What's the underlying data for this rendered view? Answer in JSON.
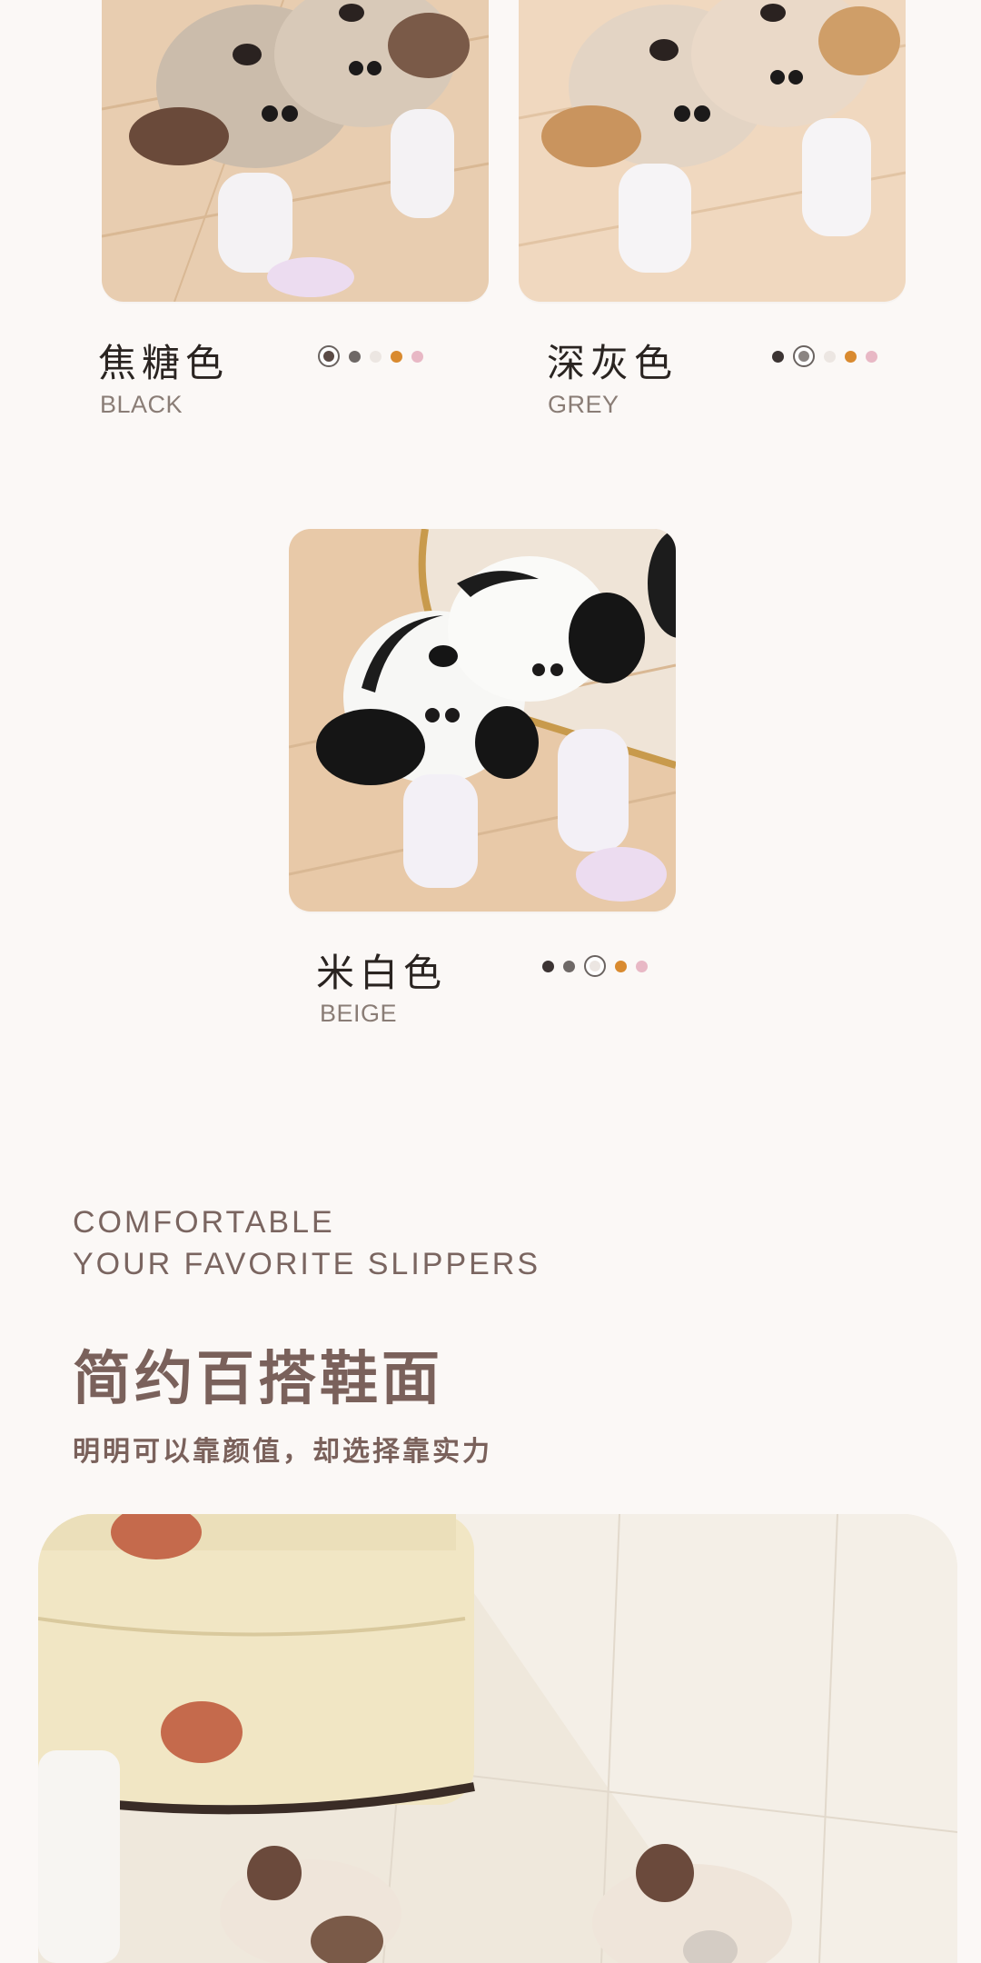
{
  "variants": [
    {
      "name_cn": "焦糖色",
      "name_en": "BLACK",
      "selected_index": 0
    },
    {
      "name_cn": "深灰色",
      "name_en": "GREY",
      "selected_index": 1
    },
    {
      "name_cn": "米白色",
      "name_en": "BEIGE",
      "selected_index": 2
    }
  ],
  "swatch_colors": [
    "#5a4a45",
    "#6e6866",
    "#ece6e2",
    "#d98a2f",
    "#e8b8c5"
  ],
  "headline": {
    "en_line1": "COMFORTABLE",
    "en_line2": "YOUR FAVORITE SLIPPERS",
    "cn_title": "简约百搭鞋面",
    "cn_tagline": "明明可以靠颜值，却选择靠实力"
  },
  "icons": {
    "photo": "product-photo"
  }
}
